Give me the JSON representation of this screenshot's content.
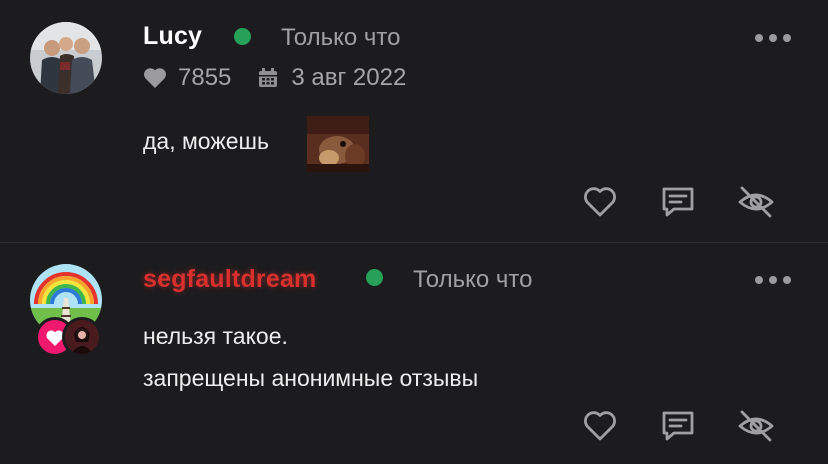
{
  "comments": [
    {
      "username": "Lucy",
      "username_color": "#ffffff",
      "status": "online",
      "time": "Только что",
      "likes": "7855",
      "date": "3 авг 2022",
      "lines": [
        "да, можешь"
      ],
      "has_sticker": true
    },
    {
      "username": "segfaultdream",
      "username_color": "#d9302e",
      "status": "online",
      "time": "Только что",
      "lines": [
        "нельзя такое.",
        "запрещены анонимные отзывы"
      ],
      "has_badges": true
    }
  ],
  "icons": {
    "like": "heart-outline-icon",
    "reply": "message-square-icon",
    "hide": "eye-off-icon",
    "more": "more-horizontal-icon",
    "likes_counter": "heart-filled-icon",
    "date": "calendar-icon"
  },
  "colors": {
    "background": "#1c1c1e",
    "online": "#27a15a",
    "accent_red": "#d9302e",
    "muted": "#a0a0a4"
  }
}
